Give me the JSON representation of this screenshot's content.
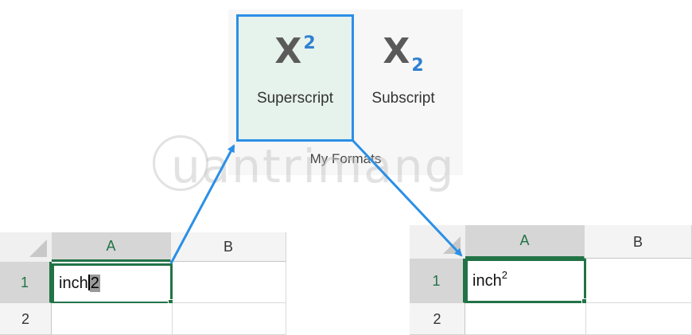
{
  "ribbon": {
    "superscript": {
      "glyph": "X",
      "exponent": "2",
      "label": "Superscript"
    },
    "subscript": {
      "glyph": "X",
      "index": "2",
      "label": "Subscript"
    },
    "group_name": "My Formats"
  },
  "watermark": {
    "text": "uantrimang"
  },
  "sheet_left": {
    "columns": [
      "A",
      "B"
    ],
    "rows": [
      "1",
      "2"
    ],
    "cell_a1": {
      "base": "inch",
      "selected_char": "2"
    }
  },
  "sheet_right": {
    "columns": [
      "A",
      "B"
    ],
    "rows": [
      "1",
      "2"
    ],
    "cell_a1": {
      "base": "inch",
      "superscript": "2"
    }
  },
  "colors": {
    "accent_blue": "#2b8fe6",
    "excel_green": "#217346"
  }
}
